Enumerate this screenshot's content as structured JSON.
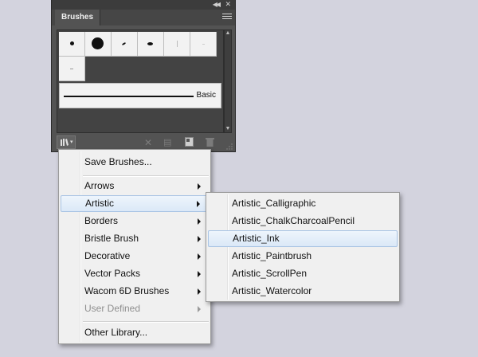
{
  "panel": {
    "tab_label": "Brushes",
    "basic_label": "Basic"
  },
  "main_menu": {
    "items": [
      {
        "label": "Save Brushes..."
      },
      {
        "label": "Arrows"
      },
      {
        "label": "Artistic"
      },
      {
        "label": "Borders"
      },
      {
        "label": "Bristle Brush"
      },
      {
        "label": "Decorative"
      },
      {
        "label": "Vector Packs"
      },
      {
        "label": "Wacom 6D Brushes"
      },
      {
        "label": "User Defined"
      },
      {
        "label": "Other Library..."
      }
    ]
  },
  "submenu": {
    "items": [
      {
        "label": "Artistic_Calligraphic"
      },
      {
        "label": "Artistic_ChalkCharcoalPencil"
      },
      {
        "label": "Artistic_Ink"
      },
      {
        "label": "Artistic_Paintbrush"
      },
      {
        "label": "Artistic_ScrollPen"
      },
      {
        "label": "Artistic_Watercolor"
      }
    ]
  },
  "icons": {
    "collapse": "double-chevron-left-icon",
    "close": "close-icon",
    "panel_menu": "panel-menu-icon",
    "library": "brush-library-icon",
    "remove_stroke": "remove-stroke-icon",
    "options": "brush-options-icon",
    "new_brush": "new-brush-icon",
    "delete": "trash-icon",
    "submenu_arrow": "chevron-right-icon"
  },
  "colors": {
    "page_bg": "#d3d3de",
    "panel_bg": "#535353",
    "menu_bg": "#f0f0f0",
    "highlight": "#dbe8f7"
  }
}
